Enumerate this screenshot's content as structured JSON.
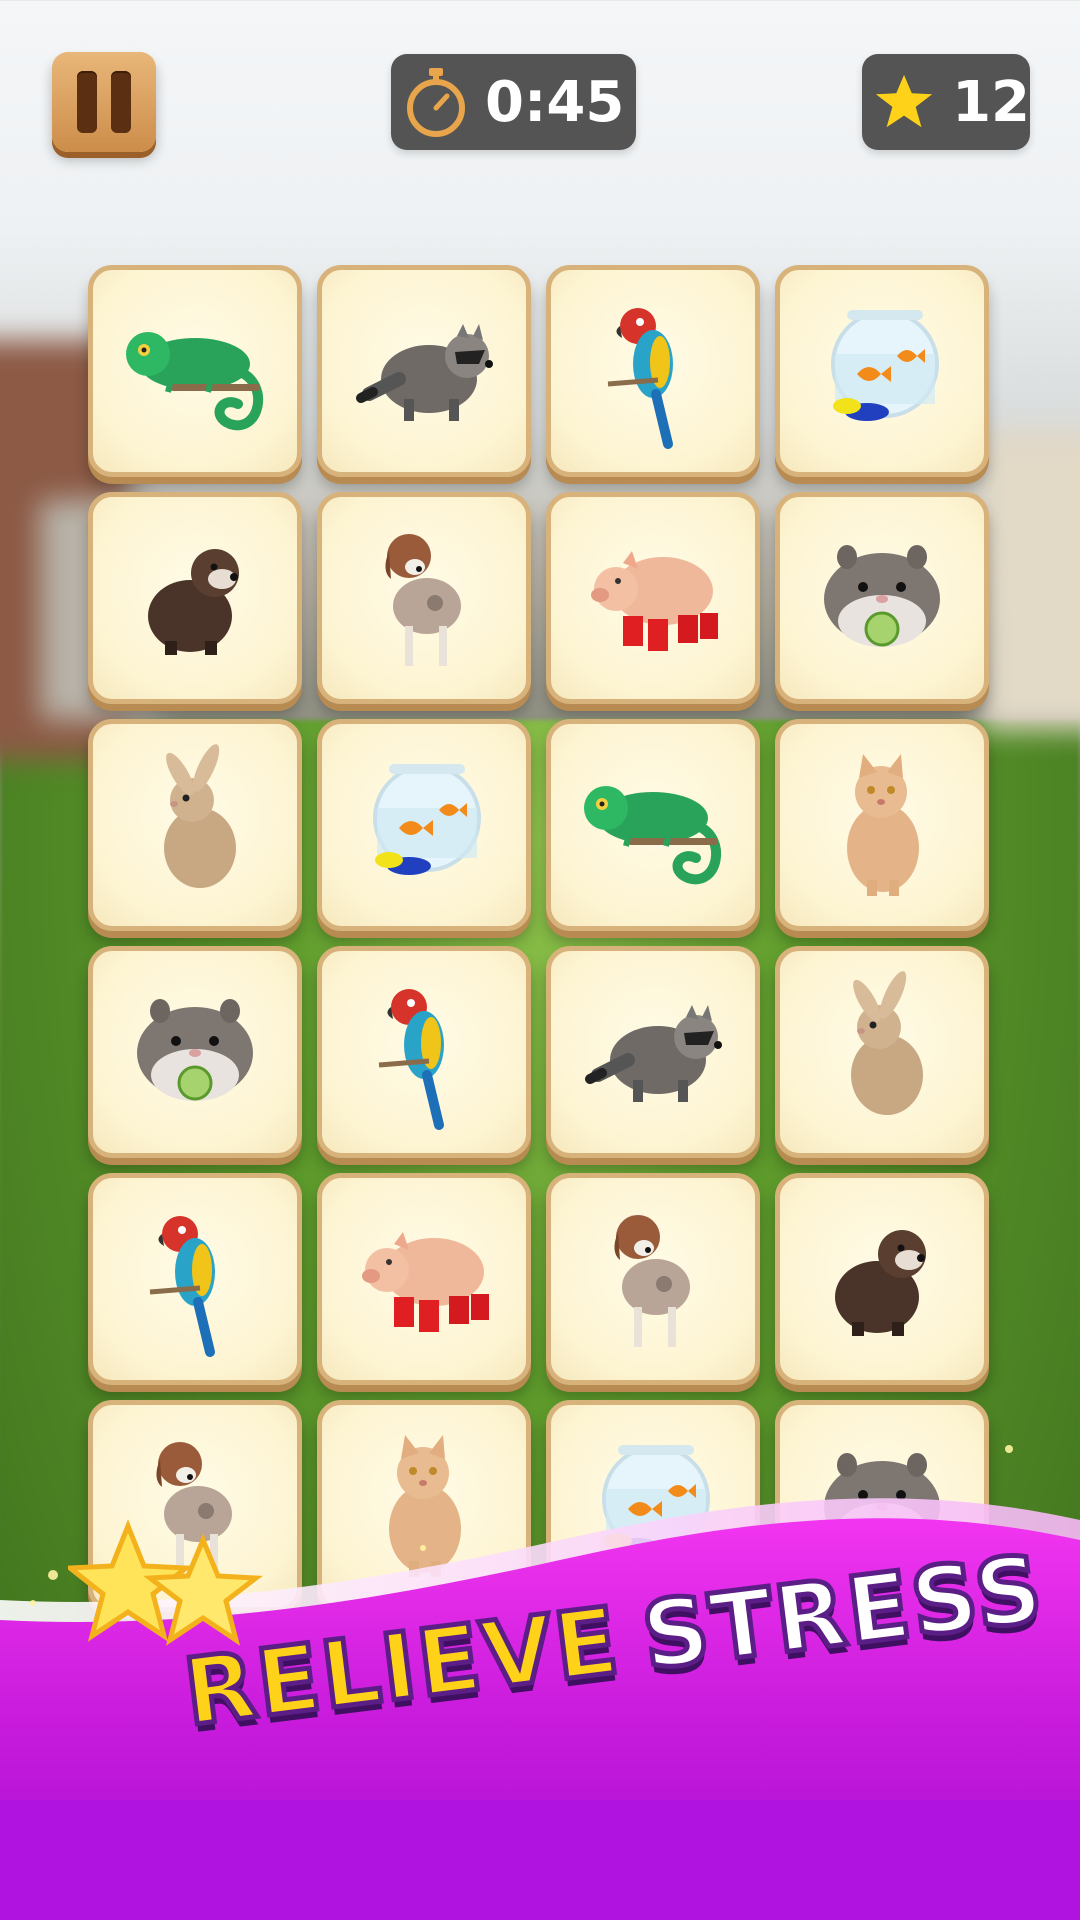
{
  "hud": {
    "timer": "0:45",
    "score": "12",
    "pause_icon": "pause-icon",
    "timer_icon": "stopwatch-icon",
    "score_icon": "star-icon"
  },
  "colors": {
    "hud_bg": "#545454",
    "tile_bg": "#fdf4d2",
    "tile_border": "#d8b27b",
    "banner_magenta": "#d81fe6",
    "banner_yellow": "#ffd21a"
  },
  "board": {
    "columns": 4,
    "tiles": [
      [
        "chameleon",
        "raccoon",
        "parrot",
        "fishbowl-frog"
      ],
      [
        "ferret",
        "dog",
        "pig-in-boots",
        "hamster"
      ],
      [
        "rabbit",
        "fishbowl-frog",
        "chameleon",
        "cat"
      ],
      [
        "hamster",
        "parrot",
        "raccoon",
        "rabbit"
      ],
      [
        "parrot",
        "pig-in-boots",
        "dog",
        "ferret"
      ],
      [
        "dog",
        "cat",
        "fishbowl-frog",
        "hamster"
      ]
    ]
  },
  "banner": {
    "word1": "RELIEVE",
    "word2": "STRESS"
  }
}
